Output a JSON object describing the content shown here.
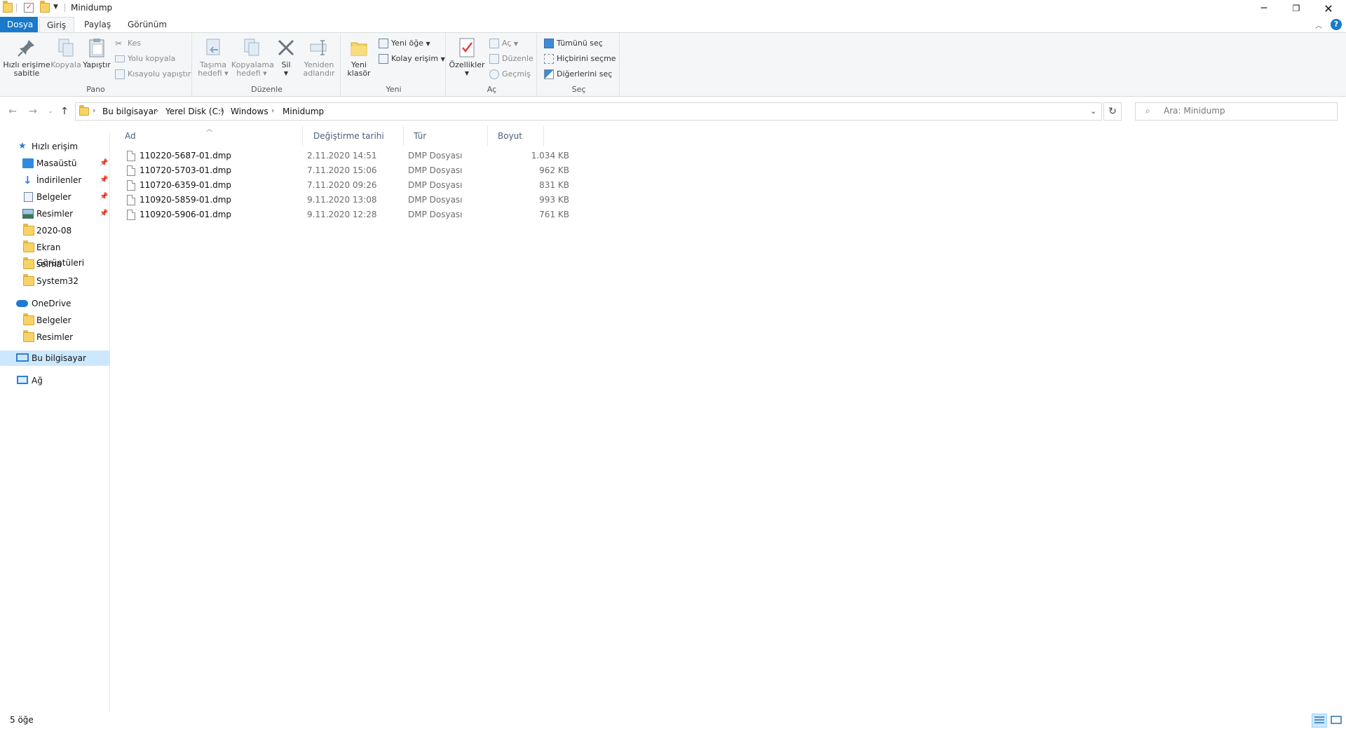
{
  "window": {
    "title": "Minidump"
  },
  "tabs": [
    {
      "label": "Dosya"
    },
    {
      "label": "Giriş"
    },
    {
      "label": "Paylaş"
    },
    {
      "label": "Görünüm"
    }
  ],
  "ribbon": {
    "pano": {
      "label": "Pano",
      "pin": "Hızlı erişime sabitle",
      "pin_line1": "Hızlı erişime",
      "pin_line2": "sabitle",
      "copy": "Kopyala",
      "paste": "Yapıştır",
      "cut": "Kes",
      "copy_path": "Yolu kopyala",
      "paste_shortcut": "Kısayolu yapıştır"
    },
    "duzenle": {
      "label": "Düzenle",
      "move_line1": "Taşıma",
      "move_line2": "hedefi",
      "copyto_line1": "Kopyalama",
      "copyto_line2": "hedefi",
      "delete": "Sil",
      "rename_line1": "Yeniden",
      "rename_line2": "adlandır"
    },
    "yeni": {
      "label": "Yeni",
      "folder_line1": "Yeni",
      "folder_line2": "klasör",
      "new_item": "Yeni öğe",
      "easy_access": "Kolay erişim"
    },
    "ac": {
      "label": "Aç",
      "properties": "Özellikler",
      "open": "Aç",
      "edit": "Düzenle",
      "history": "Geçmiş"
    },
    "sec": {
      "label": "Seç",
      "select_all": "Tümünü seç",
      "select_none": "Hiçbirini seçme",
      "invert": "Diğerlerini seç"
    }
  },
  "address": {
    "crumbs": [
      "Bu bilgisayar",
      "Yerel Disk (C:)",
      "Windows",
      "Minidump"
    ]
  },
  "search": {
    "placeholder": "Ara: Minidump"
  },
  "nav": {
    "quick_access": "Hızlı erişim",
    "items": [
      {
        "label": "Masaüstü",
        "pinned": true
      },
      {
        "label": "İndirilenler",
        "pinned": true
      },
      {
        "label": "Belgeler",
        "pinned": true
      },
      {
        "label": "Resimler",
        "pinned": true
      },
      {
        "label": "2020-08",
        "pinned": false
      },
      {
        "label": "Ekran Görüntüleri",
        "pinned": false
      },
      {
        "label": "selma",
        "pinned": false
      },
      {
        "label": "System32",
        "pinned": false
      }
    ],
    "onedrive": "OneDrive",
    "onedrive_items": [
      {
        "label": "Belgeler"
      },
      {
        "label": "Resimler"
      }
    ],
    "this_pc": "Bu bilgisayar",
    "network": "Ağ"
  },
  "columns": {
    "name": "Ad",
    "date": "Değiştirme tarihi",
    "type": "Tür",
    "size": "Boyut"
  },
  "files": [
    {
      "name": "110220-5687-01.dmp",
      "date": "2.11.2020 14:51",
      "type": "DMP Dosyası",
      "size": "1.034 KB"
    },
    {
      "name": "110720-5703-01.dmp",
      "date": "7.11.2020 15:06",
      "type": "DMP Dosyası",
      "size": "962 KB"
    },
    {
      "name": "110720-6359-01.dmp",
      "date": "7.11.2020 09:26",
      "type": "DMP Dosyası",
      "size": "831 KB"
    },
    {
      "name": "110920-5859-01.dmp",
      "date": "9.11.2020 13:08",
      "type": "DMP Dosyası",
      "size": "993 KB"
    },
    {
      "name": "110920-5906-01.dmp",
      "date": "9.11.2020 12:28",
      "type": "DMP Dosyası",
      "size": "761 KB"
    }
  ],
  "status": {
    "count": "5 öğe"
  },
  "colors": {
    "accent": "#1979ca",
    "selection": "#cce8ff",
    "folder": "#f6d365"
  }
}
